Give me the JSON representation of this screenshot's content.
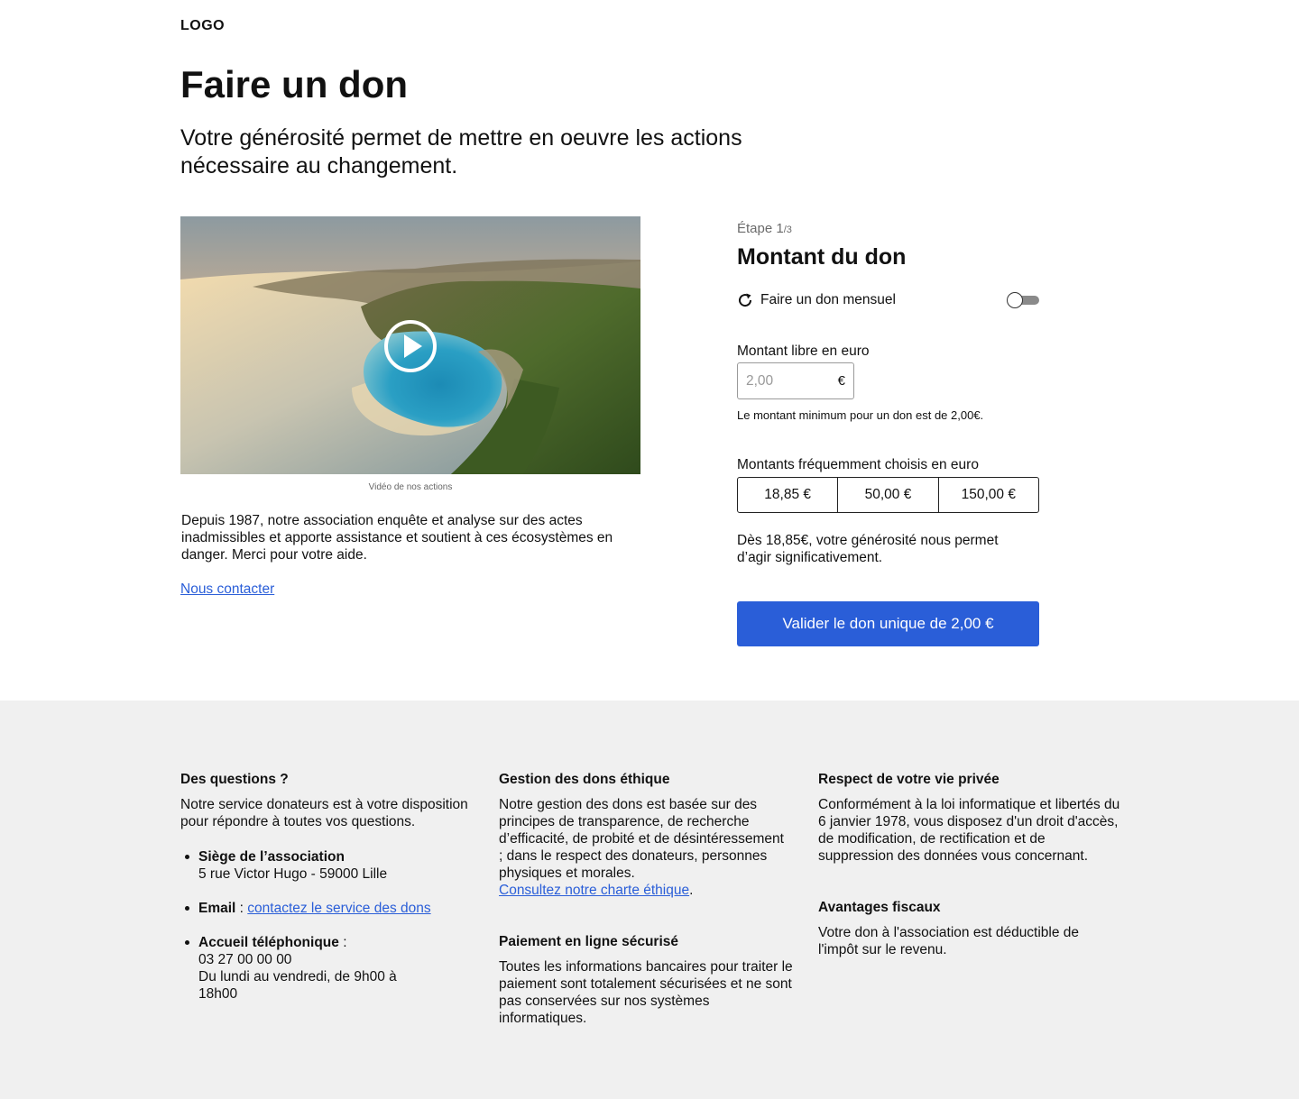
{
  "header": {
    "logo": "LOGO"
  },
  "hero": {
    "title": "Faire un don",
    "subtitle": "Votre générosité permet de mettre en oeuvre les actions nécessaire au changement."
  },
  "media": {
    "caption": "Vidéo de nos actions",
    "intro": "Depuis 1987, notre association enquête et analyse sur des actes inadmissibles et apporte  assistance et soutient à ces écosystèmes en danger. Merci pour votre aide.",
    "contact_link": "Nous contacter"
  },
  "form": {
    "step_label": "Étape 1",
    "step_total": "/3",
    "title": "Montant du don",
    "monthly_label": "Faire un don mensuel",
    "monthly_enabled": false,
    "amount_label": "Montant libre en euro",
    "amount_placeholder": "2,00",
    "currency": "€",
    "min_note": "Le montant minimum pour un don est de 2,00€.",
    "frequent_label": "Montants fréquemment choisis en euro",
    "frequent_amounts": [
      "18,85 €",
      "50,00 €",
      "150,00 €"
    ],
    "impact_note": "Dès 18,85€, votre générosité nous permet d’agir significativement.",
    "submit_label": "Valider le don unique de 2,00 €",
    "accent_color": "#2a5ed8"
  },
  "footer": {
    "questions": {
      "title": "Des questions ?",
      "text": "Notre service donateurs est à votre disposition pour répondre à toutes vos questions.",
      "hq_label": "Siège de l’association",
      "hq_address": "5 rue Victor Hugo - 59000 Lille",
      "email_label": "Email",
      "email_sep": " : ",
      "email_link": "contactez le service des dons",
      "phone_label": "Accueil téléphonique",
      "phone_sep": " :",
      "phone_number": "03 27 00 00 00",
      "phone_hours": "Du lundi au vendredi, de 9h00 à 18h00"
    },
    "ethics": {
      "title": "Gestion des dons éthique",
      "text": "Notre gestion des dons est basée sur des principes de transparence, de recherche d’efficacité, de probité et de désintéressement ; dans le respect des donateurs, personnes physiques et morales.",
      "link": "Consultez notre charte éthique",
      "link_suffix": "."
    },
    "payment": {
      "title": "Paiement en ligne sécurisé",
      "text": "Toutes les informations bancaires pour traiter le paiement sont totalement sécurisées et ne sont pas conservées sur nos systèmes informatiques."
    },
    "privacy": {
      "title": "Respect de votre vie privée",
      "text": "Conformément à la loi informatique et libertés du 6 janvier 1978, vous disposez d'un droit d'accès, de modification, de rectification et de suppression des données vous concernant."
    },
    "tax": {
      "title": "Avantages fiscaux",
      "text": "Votre don à l'association est déductible de l'impôt sur le revenu."
    }
  },
  "colors": {
    "footer_bg": "#f0f0f0",
    "link": "#2a5ed8"
  },
  "icons": {
    "play": "play-icon",
    "refresh": "refresh-icon"
  }
}
